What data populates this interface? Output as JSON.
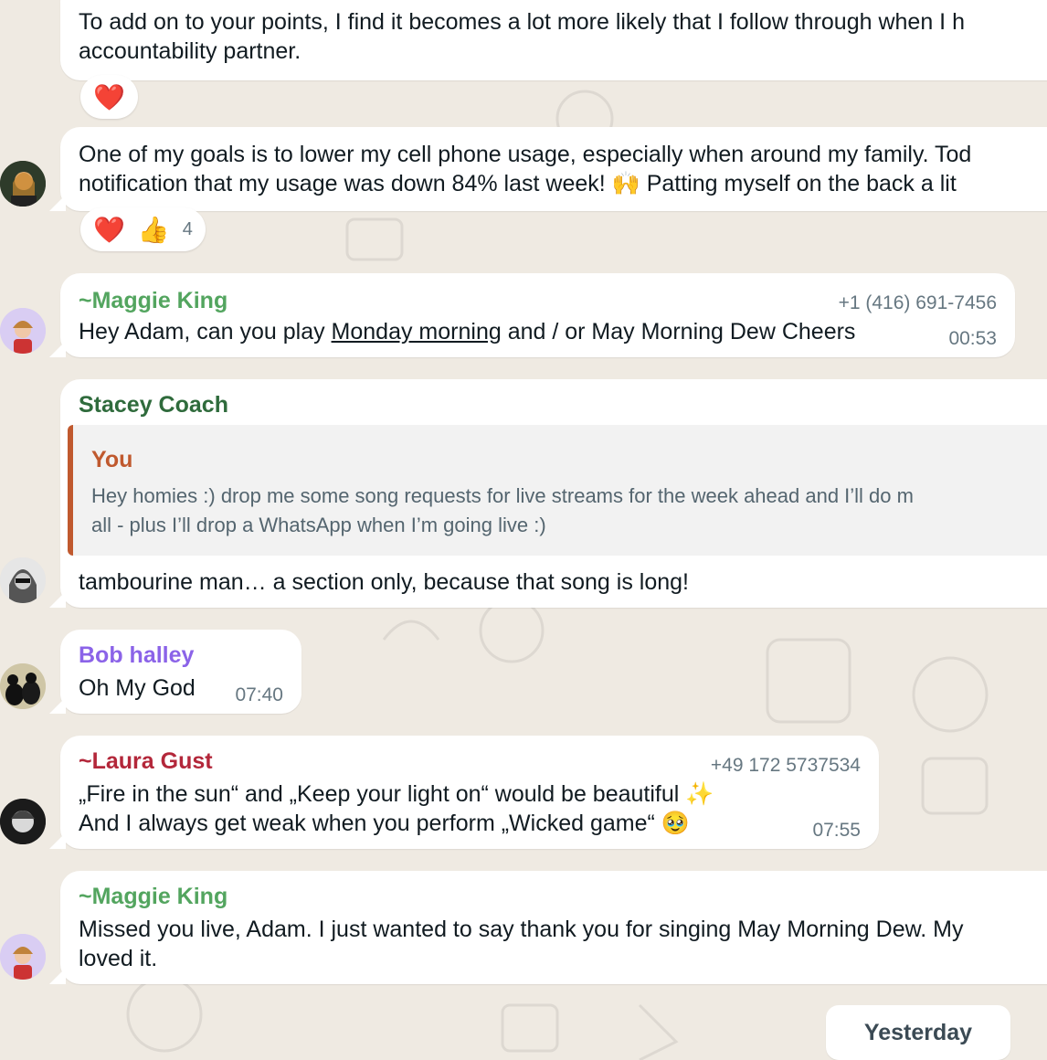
{
  "messages": [
    {
      "text_line1": "To add on to your points, I find it becomes a lot more likely that I follow through when I h",
      "text_line2": "accountability partner.",
      "reactions": [
        "❤️"
      ]
    },
    {
      "text_line1": "One of my goals is to lower my cell phone usage, especially when around my family. Tod",
      "text_line2": "notification that my usage was down 84% last week! 🙌 Patting myself on the back a lit",
      "reactions": [
        "❤️",
        "👍"
      ],
      "reaction_count": "4"
    },
    {
      "sender_prefix": "~",
      "sender": "Maggie  King",
      "phone": "+1 (416) 691-7456",
      "text_a": "Hey Adam, can you play ",
      "text_link": "Monday morning",
      "text_b": " and / or May Morning Dew Cheers",
      "time": "00:53"
    },
    {
      "sender": "Stacey Coach",
      "quote_author": "You",
      "quote_line1": "Hey homies :) drop me some song requests for live streams  for the week ahead and I’ll do m",
      "quote_line2": "all - plus I’ll drop a WhatsApp when I’m going live :)",
      "text": "tambourine man… a section only, because that song is long!"
    },
    {
      "sender": "Bob halley",
      "text": "Oh My God",
      "time": "07:40"
    },
    {
      "sender_prefix": "~",
      "sender": "Laura Gust",
      "phone": "+49 172 5737534",
      "text_line1": "„Fire in the sun“ and „Keep your light on“ would be beautiful ✨",
      "text_line2": "And I always get weak when you perform „Wicked game“ 🥹",
      "time": "07:55"
    },
    {
      "sender_prefix": "~",
      "sender": "Maggie  King",
      "text_line1": "Missed you live, Adam. I just wanted to say thank you for singing May Morning Dew. My",
      "text_line2": "loved it."
    }
  ],
  "date_divider": "Yesterday",
  "colors": {
    "maggie": "#53a55f",
    "stacey": "#2f6b3c",
    "you": "#c0592e",
    "bob": "#8b63e8",
    "laura": "#b3273a",
    "background": "#efeae2"
  }
}
